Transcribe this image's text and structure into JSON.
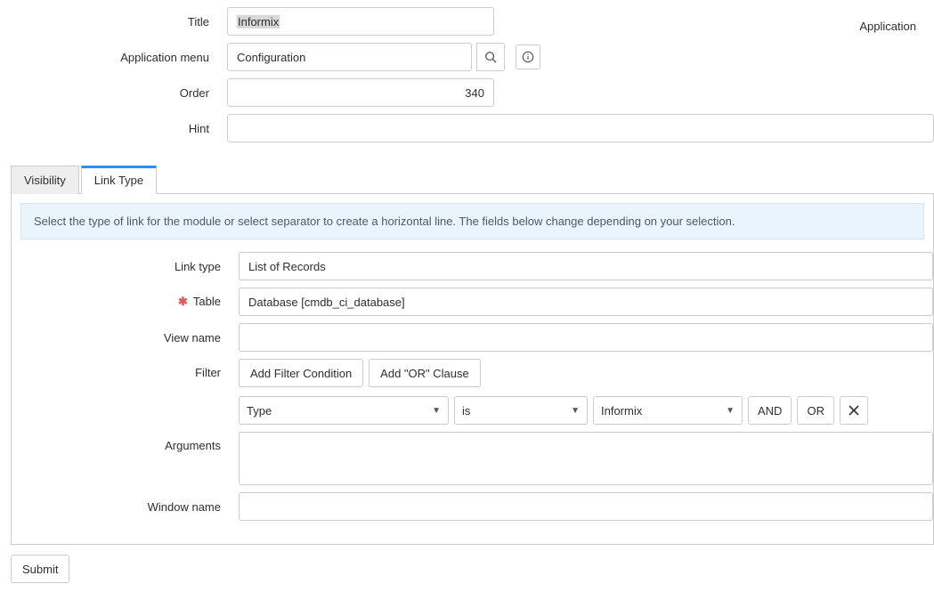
{
  "labels": {
    "title": "Title",
    "application": "Application",
    "application_menu": "Application menu",
    "order": "Order",
    "hint": "Hint",
    "link_type": "Link type",
    "table": "Table",
    "view_name": "View name",
    "filter": "Filter",
    "arguments": "Arguments",
    "window_name": "Window name"
  },
  "tabs": {
    "visibility": "Visibility",
    "link_type": "Link Type"
  },
  "values": {
    "title": "Informix",
    "application_menu": "Configuration",
    "order": "340",
    "hint": "",
    "link_type": "List of Records",
    "table": "Database [cmdb_ci_database]",
    "view_name": "",
    "arguments": "",
    "window_name": ""
  },
  "filter": {
    "add_condition": "Add Filter Condition",
    "add_or": "Add \"OR\" Clause",
    "field": "Type",
    "operator": "is",
    "value": "Informix",
    "and": "AND",
    "or": "OR"
  },
  "banner": "Select the type of link for the module or select separator to create a horizontal line. The fields below change depending on your selection.",
  "buttons": {
    "submit": "Submit"
  }
}
